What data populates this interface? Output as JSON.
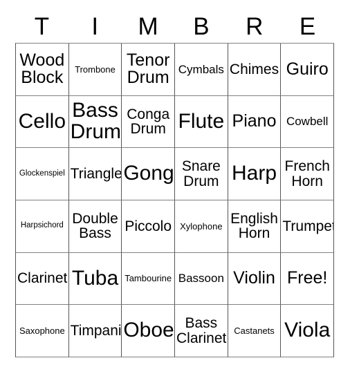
{
  "card": {
    "header_letters": [
      "T",
      "I",
      "M",
      "B",
      "R",
      "E"
    ],
    "rows": [
      [
        {
          "label": "Wood Block",
          "size": "lg"
        },
        {
          "label": "Trombone",
          "size": "xs"
        },
        {
          "label": "Tenor Drum",
          "size": "lg"
        },
        {
          "label": "Cymbals",
          "size": "sm"
        },
        {
          "label": "Chimes",
          "size": "md"
        },
        {
          "label": "Guiro",
          "size": "lg"
        }
      ],
      [
        {
          "label": "Cello",
          "size": "xl"
        },
        {
          "label": "Bass Drum",
          "size": "xl"
        },
        {
          "label": "Conga Drum",
          "size": "md"
        },
        {
          "label": "Flute",
          "size": "xl"
        },
        {
          "label": "Piano",
          "size": "lg"
        },
        {
          "label": "Cowbell",
          "size": "sm"
        }
      ],
      [
        {
          "label": "Glockenspiel",
          "size": "xxs"
        },
        {
          "label": "Triangle",
          "size": "md"
        },
        {
          "label": "Gong",
          "size": "xl"
        },
        {
          "label": "Snare Drum",
          "size": "md"
        },
        {
          "label": "Harp",
          "size": "xl"
        },
        {
          "label": "French Horn",
          "size": "md"
        }
      ],
      [
        {
          "label": "Harpsichord",
          "size": "xxs"
        },
        {
          "label": "Double Bass",
          "size": "md"
        },
        {
          "label": "Piccolo",
          "size": "md"
        },
        {
          "label": "Xylophone",
          "size": "xs"
        },
        {
          "label": "English Horn",
          "size": "md"
        },
        {
          "label": "Trumpet",
          "size": "md"
        }
      ],
      [
        {
          "label": "Clarinet",
          "size": "md"
        },
        {
          "label": "Tuba",
          "size": "xl"
        },
        {
          "label": "Tambourine",
          "size": "xs"
        },
        {
          "label": "Bassoon",
          "size": "sm"
        },
        {
          "label": "Violin",
          "size": "lg"
        },
        {
          "label": "Free!",
          "size": "lg"
        }
      ],
      [
        {
          "label": "Saxophone",
          "size": "xs"
        },
        {
          "label": "Timpani",
          "size": "md"
        },
        {
          "label": "Oboe",
          "size": "xl"
        },
        {
          "label": "Bass Clarinet",
          "size": "md"
        },
        {
          "label": "Castanets",
          "size": "xs"
        },
        {
          "label": "Viola",
          "size": "xl"
        }
      ]
    ]
  }
}
